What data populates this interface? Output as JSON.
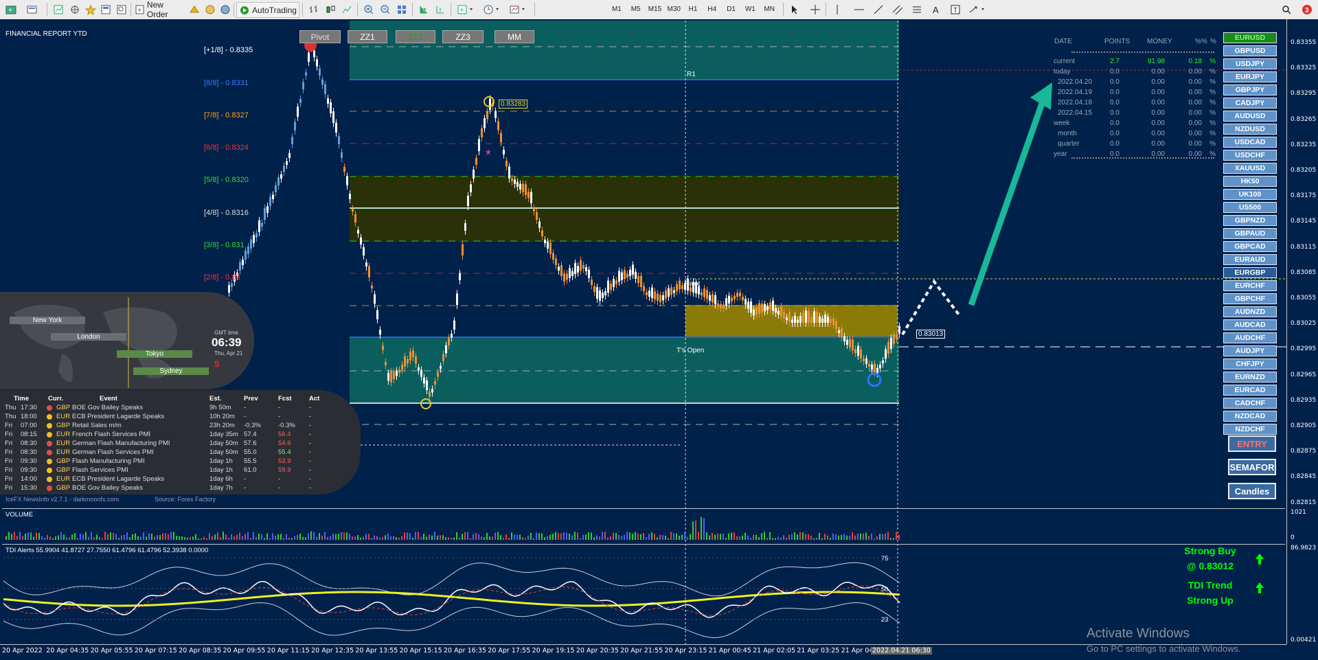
{
  "toolbar": {
    "new_order": "New Order",
    "autotrading": "AutoTrading",
    "timeframes": [
      "M1",
      "M5",
      "M15",
      "M30",
      "H1",
      "H4",
      "D1",
      "W1",
      "MN"
    ]
  },
  "report": {
    "title": "FINANCIAL REPORT YTD",
    "headers": [
      "DATE",
      "POINTS",
      "MONEY",
      "%%",
      "%"
    ],
    "rows": [
      {
        "label": "current",
        "points": "2.7",
        "money": "91.98",
        "pct": "0.18",
        "sign": "%"
      },
      {
        "label": "today",
        "points": "0.0",
        "money": "0.00",
        "pct": "0.00",
        "sign": "%"
      },
      {
        "label": "2022.04.20",
        "points": "0.0",
        "money": "0.00",
        "pct": "0.00",
        "sign": "%"
      },
      {
        "label": "2022.04.19",
        "points": "0.0",
        "money": "0.00",
        "pct": "0.00",
        "sign": "%"
      },
      {
        "label": "2022.04.18",
        "points": "0.0",
        "money": "0.00",
        "pct": "0.00",
        "sign": "%"
      },
      {
        "label": "2022.04.15",
        "points": "0.0",
        "money": "0.00",
        "pct": "0.00",
        "sign": "%"
      },
      {
        "label": "week",
        "points": "0.0",
        "money": "0.00",
        "pct": "0.00",
        "sign": "%"
      },
      {
        "label": "month",
        "points": "0.0",
        "money": "0.00",
        "pct": "0.00",
        "sign": "%"
      },
      {
        "label": "quarter",
        "points": "0.0",
        "money": "0.00",
        "pct": "0.00",
        "sign": "%"
      },
      {
        "label": "year",
        "points": "0.0",
        "money": "0.00",
        "pct": "0.00",
        "sign": "%"
      }
    ]
  },
  "toggles": [
    "Pivot",
    "ZZ1",
    "ZZ2",
    "ZZ3",
    "MM"
  ],
  "murrey": [
    {
      "label": "[+1/8] - 0.8335",
      "color": "#ffffff"
    },
    {
      "label": "[8/8] - 0.8331",
      "color": "#3a7bff"
    },
    {
      "label": "[7/8] - 0.8327",
      "color": "#ffa020"
    },
    {
      "label": "[6/8] - 0.8324",
      "color": "#ff3030"
    },
    {
      "label": "[5/8] - 0.8320",
      "color": "#33dd33"
    },
    {
      "label": "[4/8] - 0.8316",
      "color": "#dddddd"
    },
    {
      "label": "[3/8] - 0.831",
      "color": "#33dd33"
    },
    {
      "label": "[2/8] - 0.83",
      "color": "#ff3030"
    }
  ],
  "chart_labels": {
    "r1": "R1",
    "pivot": "Pivot",
    "ts_open": "T's Open",
    "price_tag": "0.83283",
    "current_price": "0.83013",
    "volume": "VOLUME",
    "tdi": "TDI Alerts  55.9904 41.8727 27.7550 61.4796 61.4796 52.3938 0.0000",
    "tdi_levels": [
      "75",
      "50",
      "23"
    ]
  },
  "clock": {
    "gmt_label": "GMT time",
    "time": "06:39",
    "date": "Thu, Apr 21",
    "sessions": [
      "New York",
      "London",
      "Tokyo",
      "Sydney"
    ],
    "marker": "S"
  },
  "news": {
    "headers": [
      "Time",
      "Curr.",
      "Event",
      "Est.",
      "Prev",
      "Fcst",
      "Act"
    ],
    "rows": [
      {
        "day": "Thu",
        "time": "17:30",
        "curr": "GBP",
        "event": "BOE Gov Bailey Speaks",
        "est": "9h 50m",
        "prev": "-",
        "fcst": "-",
        "act": "-",
        "dot": "#e05050",
        "fcolor": "#ddd"
      },
      {
        "day": "Thu",
        "time": "18:00",
        "curr": "EUR",
        "event": "ECB President Lagarde Speaks",
        "est": "10h 20m",
        "prev": "-",
        "fcst": "-",
        "act": "-",
        "dot": "#f0c020",
        "fcolor": "#ddd"
      },
      {
        "day": "Fri",
        "time": "07:00",
        "curr": "GBP",
        "event": "Retail Sales m/m",
        "est": "23h 20m",
        "prev": "-0.3%",
        "fcst": "-0.3%",
        "act": "-",
        "dot": "#f0c020",
        "fcolor": "#ddd"
      },
      {
        "day": "Fri",
        "time": "08:15",
        "curr": "EUR",
        "event": "French Flash Services PMI",
        "est": "1day 35m",
        "prev": "57.4",
        "fcst": "56.4",
        "act": "-",
        "dot": "#f0c020",
        "fcolor": "#ff6060"
      },
      {
        "day": "Fri",
        "time": "08:30",
        "curr": "EUR",
        "event": "German Flash Manufacturing PMI",
        "est": "1day 50m",
        "prev": "57.6",
        "fcst": "54.6",
        "act": "-",
        "dot": "#e05050",
        "fcolor": "#ff6060"
      },
      {
        "day": "Fri",
        "time": "08:30",
        "curr": "EUR",
        "event": "German Flash Services PMI",
        "est": "1day 50m",
        "prev": "55.0",
        "fcst": "55.4",
        "act": "-",
        "dot": "#e05050",
        "fcolor": "#66ff66"
      },
      {
        "day": "Fri",
        "time": "09:30",
        "curr": "GBP",
        "event": "Flash Manufacturing PMI",
        "est": "1day 1h",
        "prev": "55.5",
        "fcst": "53.9",
        "act": "-",
        "dot": "#f0c020",
        "fcolor": "#ff6060"
      },
      {
        "day": "Fri",
        "time": "09:30",
        "curr": "GBP",
        "event": "Flash Services PMI",
        "est": "1day 1h",
        "prev": "61.0",
        "fcst": "59.9",
        "act": "-",
        "dot": "#f0c020",
        "fcolor": "#ff6060"
      },
      {
        "day": "Fri",
        "time": "14:00",
        "curr": "EUR",
        "event": "ECB President Lagarde Speaks",
        "est": "1day 6h",
        "prev": "-",
        "fcst": "-",
        "act": "-",
        "dot": "#f0c020",
        "fcolor": "#ddd"
      },
      {
        "day": "Fri",
        "time": "15:30",
        "curr": "GBP",
        "event": "BOE Gov Bailey Speaks",
        "est": "1day 7h",
        "prev": "-",
        "fcst": "-",
        "act": "-",
        "dot": "#e05050",
        "fcolor": "#ddd"
      }
    ],
    "footer": "IceFX NewsInfo v2.7.1  -  darkmoonfx.com",
    "source": "Source: Forex Factory"
  },
  "pairs": [
    "EURUSD",
    "GBPUSD",
    "USDJPY",
    "EURJPY",
    "GBPJPY",
    "CADJPY",
    "AUDUSD",
    "NZDUSD",
    "USDCAD",
    "USDCHF",
    "XAUUSD",
    "HK50",
    "UK100",
    "US500",
    "GBPNZD",
    "GBPAUD",
    "GBPCAD",
    "EURAUD",
    "EURGBP",
    "EURCHF",
    "GBPCHF",
    "AUDNZD",
    "AUDCAD",
    "AUDCHF",
    "AUDJPY",
    "CHFJPY",
    "EURNZD",
    "EURCAD",
    "CADCHF",
    "NZDCAD",
    "NZDCHF"
  ],
  "buttons": {
    "entry": "ENTRY",
    "semafor": "SEMAFOR",
    "candles": "Candles"
  },
  "tdi_signal": {
    "line1": "Strong Buy",
    "line2": "@ 0.83012",
    "line3": "TDI Trend",
    "line4": "Strong Up"
  },
  "yaxis": {
    "main": [
      "0.83355",
      "0.83325",
      "0.83295",
      "0.83265",
      "0.83235",
      "0.83205",
      "0.83175",
      "0.83145",
      "0.83115",
      "0.83085",
      "0.83055",
      "0.83025",
      "0.82995",
      "0.82965",
      "0.82935",
      "0.82905",
      "0.82875",
      "0.82845",
      "0.82815"
    ],
    "volume": [
      "1021",
      "0"
    ],
    "tdi": [
      "86.9823",
      "0.00421"
    ]
  },
  "xaxis": [
    "20 Apr 2022",
    "20 Apr 04:35",
    "20 Apr 05:55",
    "20 Apr 07:15",
    "20 Apr 08:35",
    "20 Apr 09:55",
    "20 Apr 11:15",
    "20 Apr 12:35",
    "20 Apr 13:55",
    "20 Apr 15:15",
    "20 Apr 16:35",
    "20 Apr 17:55",
    "20 Apr 19:15",
    "20 Apr 20:35",
    "20 Apr 21:55",
    "20 Apr 23:15",
    "21 Apr 00:45",
    "21 Apr 02:05",
    "21 Apr 03:25",
    "21 Apr 04:",
    "2022.04.21 06:30"
  ],
  "watermark": {
    "line1": "Activate Windows",
    "line2": "Go to PC settings to activate Windows."
  }
}
